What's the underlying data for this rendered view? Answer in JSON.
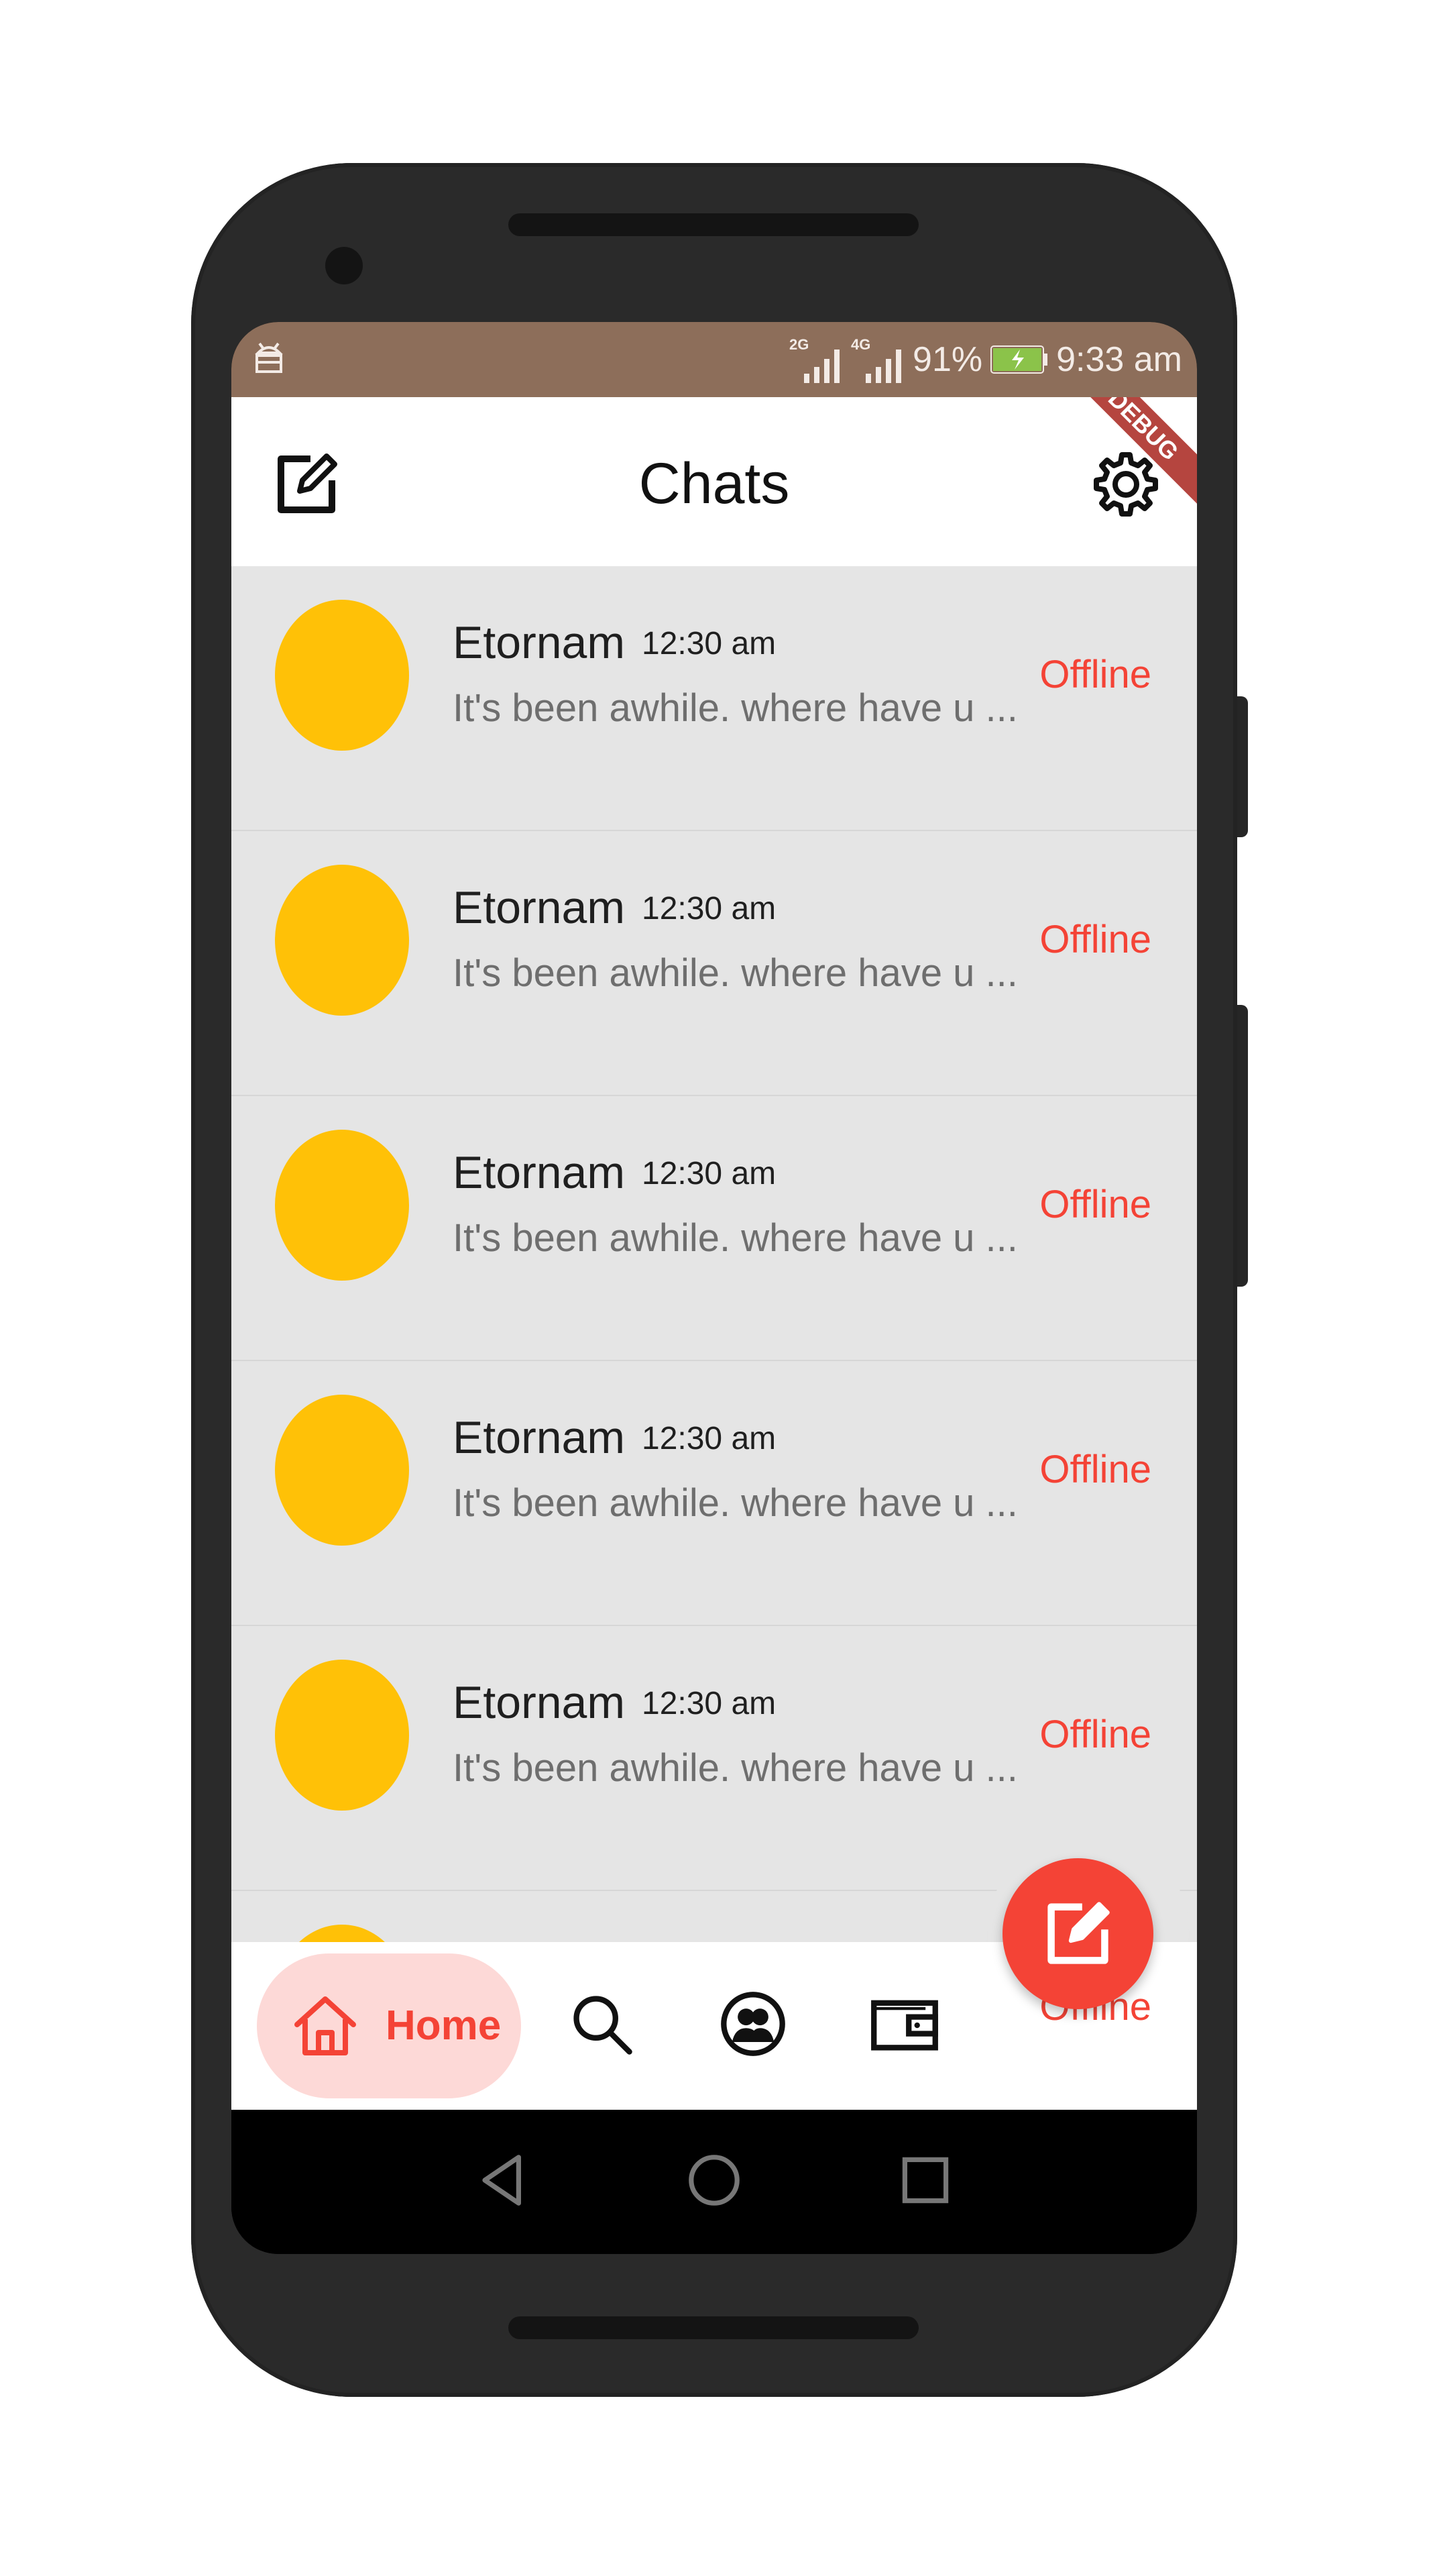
{
  "status_bar": {
    "network1": "2G",
    "network2": "4G",
    "battery_percent": "91%",
    "time": "9:33 am",
    "bg_color": "#8d6e5a"
  },
  "app_bar": {
    "title": "Chats",
    "left_icon": "edit-icon",
    "right_icon": "gear-icon",
    "debug_banner": "DEBUG"
  },
  "chats": [
    {
      "name": "Etornam",
      "time": "12:30 am",
      "preview": "It's been awhile. where have u ...",
      "status": "Offline"
    },
    {
      "name": "Etornam",
      "time": "12:30 am",
      "preview": "It's been awhile. where have u ...",
      "status": "Offline"
    },
    {
      "name": "Etornam",
      "time": "12:30 am",
      "preview": "It's been awhile. where have u ...",
      "status": "Offline"
    },
    {
      "name": "Etornam",
      "time": "12:30 am",
      "preview": "It's been awhile. where have u ...",
      "status": "Offline"
    },
    {
      "name": "Etornam",
      "time": "12:30 am",
      "preview": "It's been awhile. where have u ...",
      "status": "Offline"
    }
  ],
  "partial_row_status": "Offline",
  "bottom_nav": {
    "home_label": "Home",
    "items": [
      "home-icon",
      "search-icon",
      "contacts-icon",
      "wallet-icon"
    ]
  },
  "fab": {
    "icon": "compose-icon"
  },
  "colors": {
    "accent": "#f44336",
    "avatar": "#ffc107",
    "home_pill": "#fdd9d7",
    "list_bg": "#e5e5e5"
  }
}
